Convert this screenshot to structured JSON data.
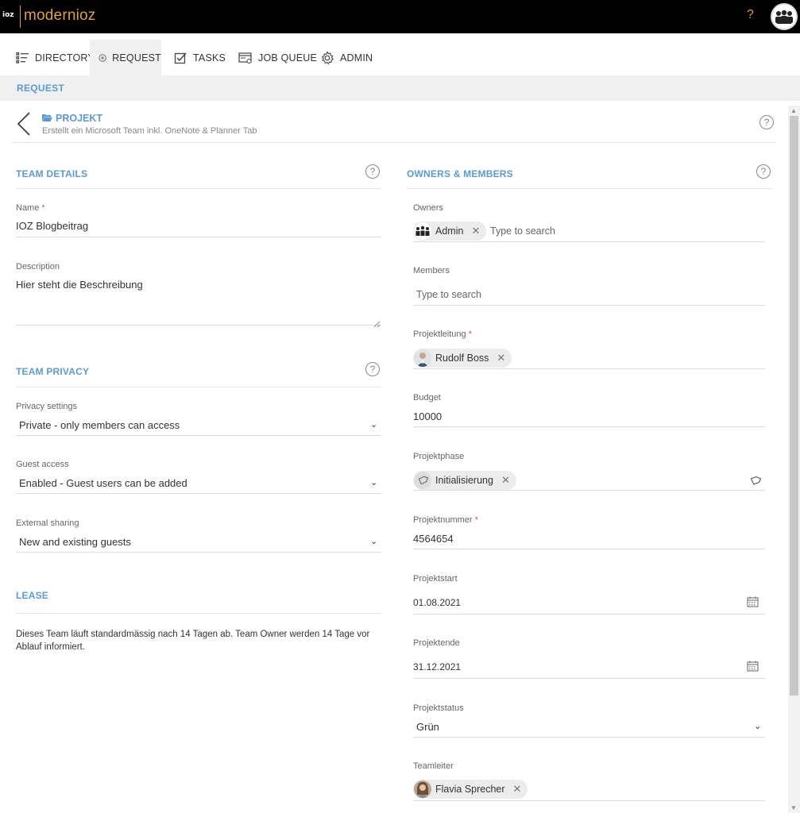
{
  "app": {
    "logo_mark": "ioz",
    "name": "modernioz",
    "help": "?"
  },
  "nav": [
    {
      "label": "DIRECTORY",
      "icon": "list-icon"
    },
    {
      "label": "REQUEST",
      "icon": "plus-circle-icon"
    },
    {
      "label": "TASKS",
      "icon": "checkbox-icon"
    },
    {
      "label": "JOB QUEUE",
      "icon": "queue-icon"
    },
    {
      "label": "ADMIN",
      "icon": "gear-icon"
    }
  ],
  "band": {
    "title": "REQUEST"
  },
  "header": {
    "title": "PROJEKT",
    "subtitle": "Erstellt ein Microsoft Team inkl. OneNote & Planner Tab"
  },
  "team_details": {
    "title": "TEAM DETAILS",
    "name_label": "Name",
    "name_value": "IOZ Blogbeitrag",
    "description_label": "Description",
    "description_value": "Hier steht die Beschreibung"
  },
  "team_privacy": {
    "title": "TEAM PRIVACY",
    "privacy_label": "Privacy settings",
    "privacy_value": "Private - only members can access",
    "guest_label": "Guest access",
    "guest_value": "Enabled - Guest users can be added",
    "sharing_label": "External sharing",
    "sharing_value": "New and existing guests"
  },
  "lease": {
    "title": "LEASE",
    "text": "Dieses Team läuft standardmässig nach 14 Tagen ab. Team Owner werden 14 Tage vor Ablauf informiert."
  },
  "owners_members": {
    "title": "OWNERS & MEMBERS",
    "owners_label": "Owners",
    "owner_chip": "Admin",
    "search_placeholder": "Type to search",
    "members_label": "Members",
    "projektleitung_label": "Projektleitung",
    "projektleitung_chip": "Rudolf Boss",
    "budget_label": "Budget",
    "budget_value": "10000",
    "projektphase_label": "Projektphase",
    "projektphase_chip": "Initialisierung",
    "projektnummer_label": "Projektnummer",
    "projektnummer_value": "4564654",
    "projektstart_label": "Projektstart",
    "projektstart_value": "01.08.2021",
    "projektende_label": "Projektende",
    "projektende_value": "31.12.2021",
    "projektstatus_label": "Projektstatus",
    "projektstatus_value": "Grün",
    "teamleiter_label": "Teamleiter",
    "teamleiter_chip": "Flavia Sprecher"
  }
}
